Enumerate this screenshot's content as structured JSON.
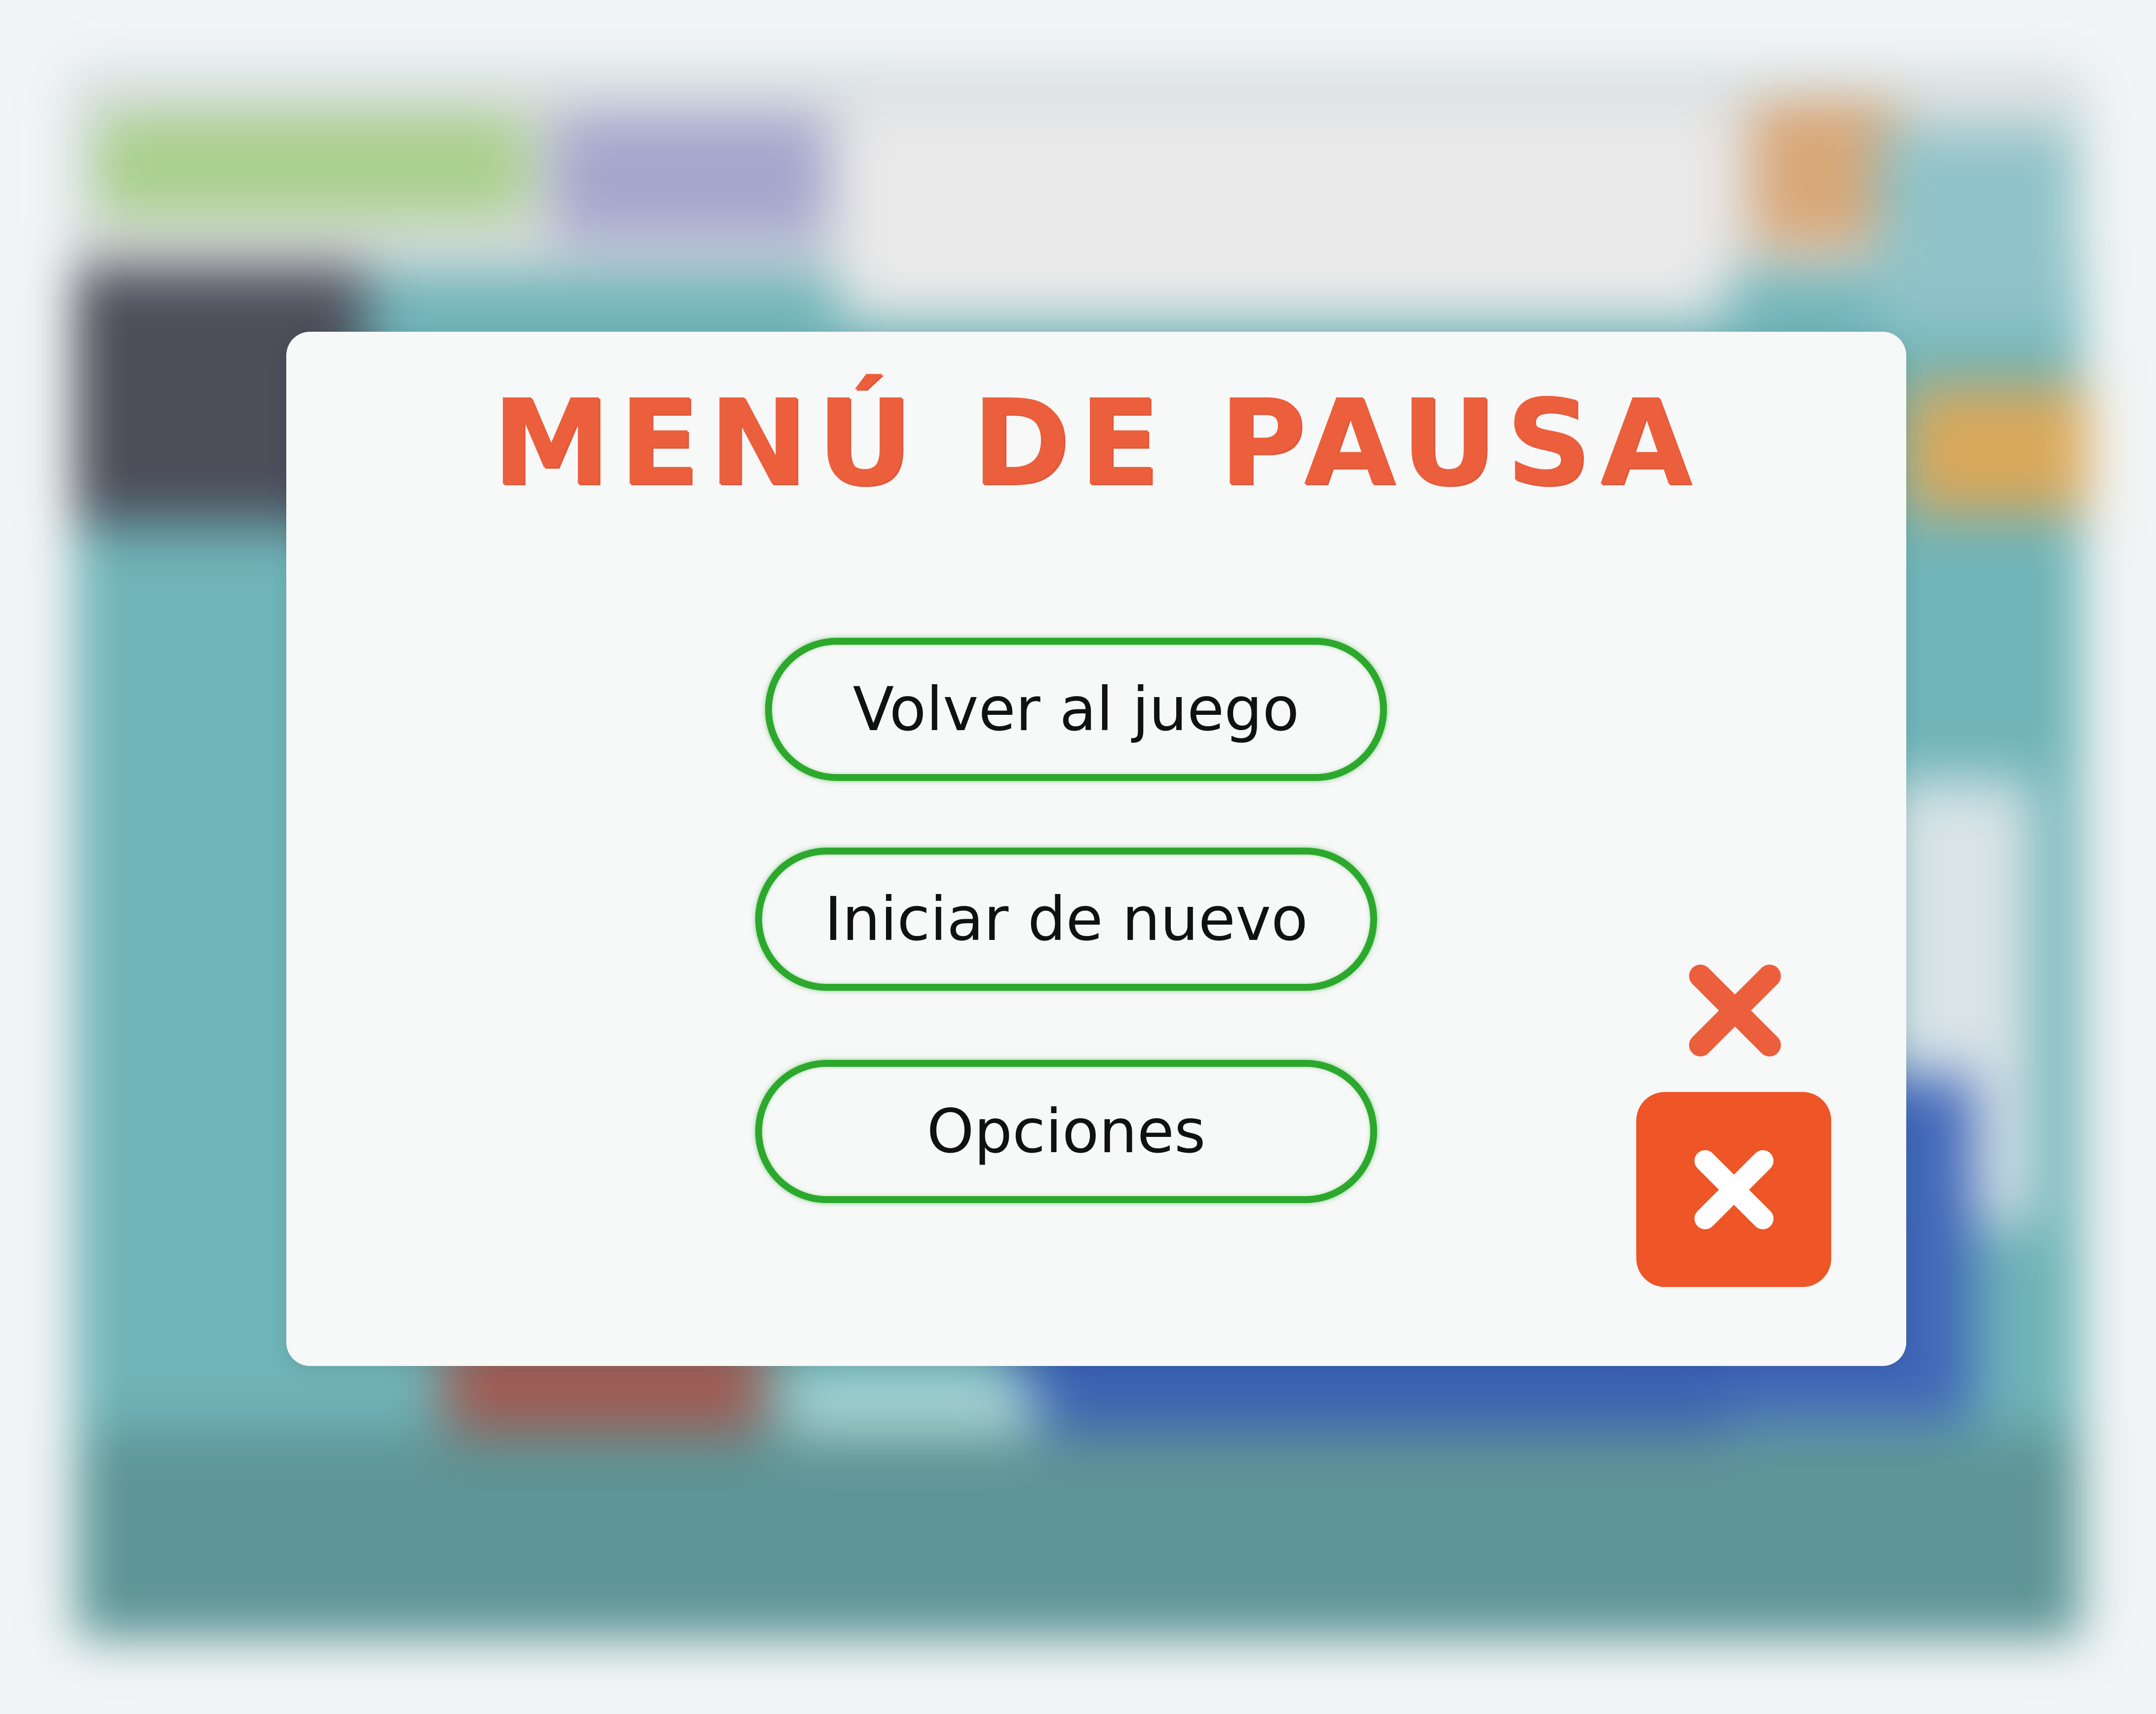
{
  "modal": {
    "title": "MENÚ DE PAUSA"
  },
  "buttons": {
    "resume": "Volver al juego",
    "restart": "Iniciar de nuevo",
    "options": "Opciones"
  },
  "close_controls": [
    {
      "icon": "close-icon",
      "style": "plain"
    },
    {
      "icon": "close-icon",
      "style": "boxed"
    }
  ],
  "colors": {
    "title": "#ec5f3c",
    "button_border": "#2ca82c",
    "close_box": "#ee5527",
    "close_icon_plain": "#ec5f3c",
    "close_icon_boxed": "#ffffff",
    "modal_background": "#f7f8f8"
  }
}
